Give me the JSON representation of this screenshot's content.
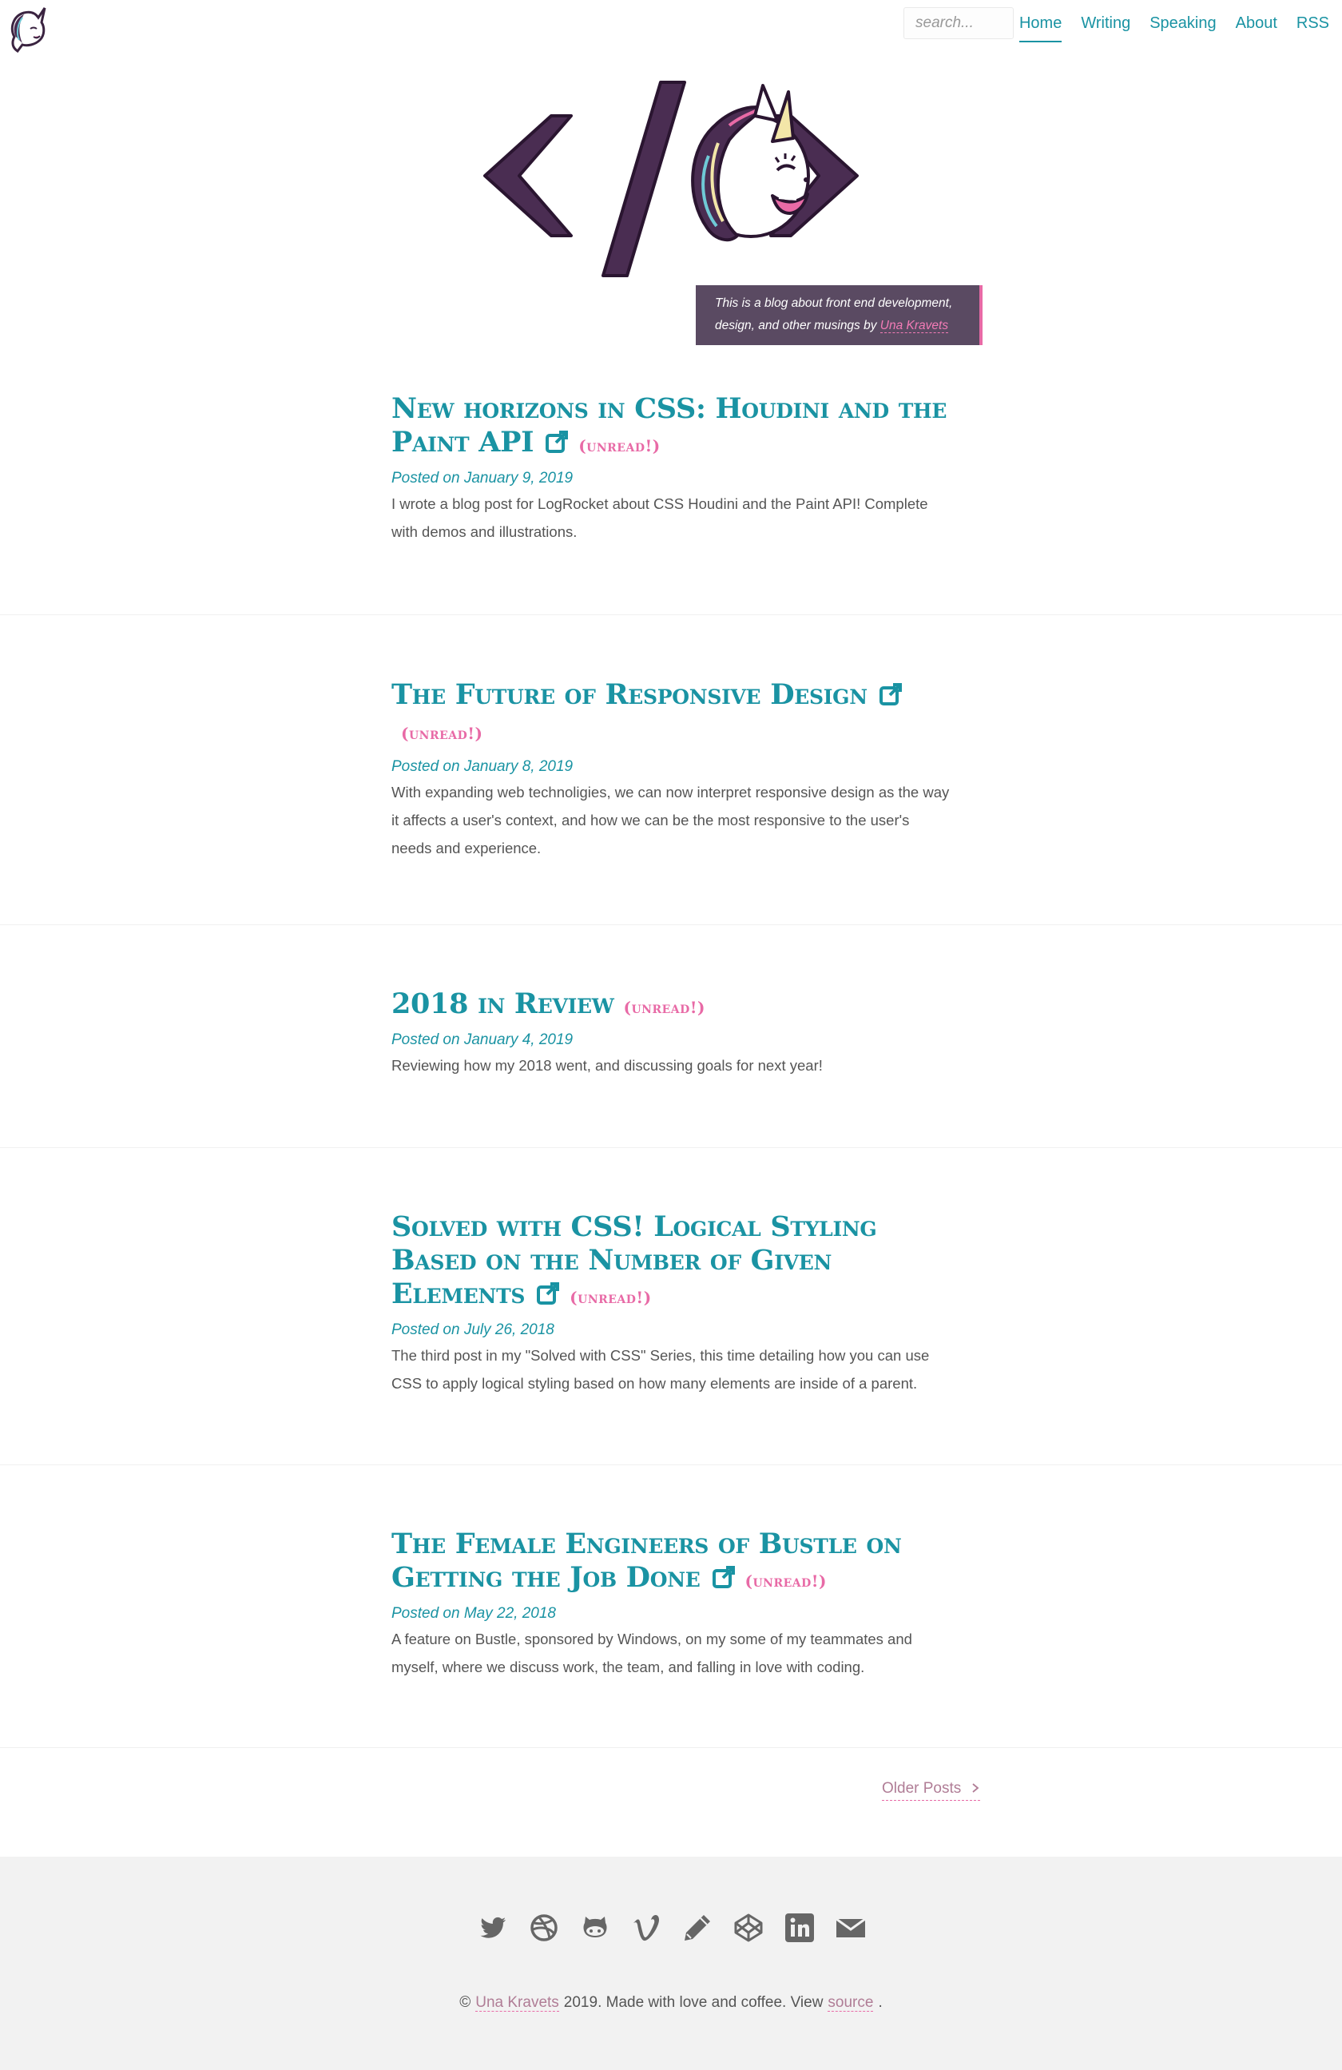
{
  "header": {
    "logo_icon": "unicorn-icon",
    "search_placeholder": "search...",
    "nav": [
      {
        "label": "Home",
        "active": true
      },
      {
        "label": "Writing",
        "active": false
      },
      {
        "label": "Speaking",
        "active": false
      },
      {
        "label": "About",
        "active": false
      },
      {
        "label": "RSS",
        "active": false
      }
    ]
  },
  "hero": {
    "logo_icon": "code-unicorn-icon",
    "tagline_text": "This is a blog about front end development, design, and other musings by",
    "tagline_author": "Una Kravets"
  },
  "posts": [
    {
      "title": "New horizons in CSS: Houdini and the Paint API",
      "external": true,
      "badge": "(unread!)",
      "date": "Posted on January 9, 2019",
      "excerpt": "I wrote a blog post for LogRocket about CSS Houdini and the Paint API! Complete with demos and illustrations."
    },
    {
      "title": "The Future of Responsive Design",
      "external": true,
      "badge": "(unread!)",
      "date": "Posted on January 8, 2019",
      "excerpt": "With expanding web technoligies, we can now interpret responsive design as the way it affects a user's context, and how we can be the most responsive to the user's needs and experience."
    },
    {
      "title": "2018 in Review",
      "external": false,
      "badge": "(unread!)",
      "date": "Posted on January 4, 2019",
      "excerpt": "Reviewing how my 2018 went, and discussing goals for next year!"
    },
    {
      "title": "Solved with CSS! Logical Styling Based on the Number of Given Elements",
      "external": true,
      "badge": "(unread!)",
      "date": "Posted on July 26, 2018",
      "excerpt": "The third post in my \"Solved with CSS\" Series, this time detailing how you can use CSS to apply logical styling based on how many elements are inside of a parent."
    },
    {
      "title": "The Female Engineers of Bustle on Getting the Job Done",
      "external": true,
      "badge": "(unread!)",
      "date": "Posted on May 22, 2018",
      "excerpt": "A feature on Bustle, sponsored by Windows, on my some of my teammates and myself, where we discuss work, the team, and falling in love with coding."
    }
  ],
  "pagination": {
    "older_label": "Older Posts",
    "older_icon": "chevron-right-icon"
  },
  "footer": {
    "social_icons": [
      "twitter-icon",
      "dribbble-icon",
      "github-icon",
      "vimeo-icon",
      "pencil-icon",
      "codepen-icon",
      "linkedin-icon",
      "email-icon"
    ],
    "copyright_prefix": "©",
    "copyright_author": "Una Kravets",
    "copyright_middle": "2019. Made with love and coffee. View",
    "copyright_link": "source",
    "copyright_suffix": "."
  },
  "colors": {
    "accent": "#1a93a3",
    "pink": "#e86aa6",
    "purple": "#4a2d52",
    "footer_bg": "#f2f2f2"
  }
}
